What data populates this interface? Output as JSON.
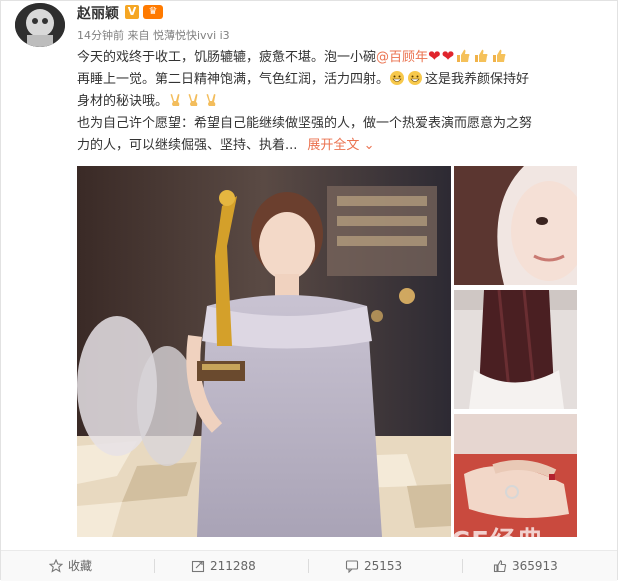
{
  "user": {
    "name": "赵丽颖",
    "vip_badge": "♛"
  },
  "meta": {
    "time": "14分钟前",
    "source_prefix": "来自",
    "source": "悦薄悦快ivvi i3"
  },
  "post": {
    "line1_text": "今天的戏终于收工，饥肠辘辘，疲惫不堪。泡一小碗",
    "line1_mention": "@百顾年",
    "line2_text": "再睡上一觉。第二日精神饱满，气色红润，活力四射。",
    "line2_tail": "这是我养颜保持好",
    "line3_text": "身材的秘诀哦。",
    "line4_text": "也为自己许个愿望：希望自己能继续做坚强的人，做一个热爱表演而愿意为之努",
    "line5_text": "力的人，可以继续倔强、坚持、执着...",
    "expand_label": "展开全文"
  },
  "watermark": "CF经典",
  "actions": {
    "favorite": "收藏",
    "repost": "211288",
    "comment": "25153",
    "like": "365913"
  },
  "colors": {
    "link": "#eb7350",
    "heart": "#e0242c",
    "badge": "#f5a623"
  }
}
